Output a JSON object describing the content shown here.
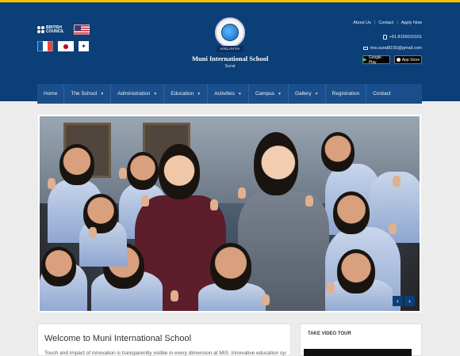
{
  "header": {
    "british_council_label": "BRITISH COUNCIL",
    "school_name": "Muni International School",
    "crest_text": "AIKLAVYA",
    "school_city": "Surat",
    "top_links": [
      "About Us",
      "Contact",
      "Apply Now"
    ],
    "phone": "+91 8155010101",
    "email": "mis.surat8155@gmail.com",
    "google_play_label": "Google Play",
    "app_store_label": "App Store"
  },
  "nav": {
    "items": [
      {
        "label": "Home",
        "dropdown": false
      },
      {
        "label": "The School",
        "dropdown": true
      },
      {
        "label": "Administration",
        "dropdown": true
      },
      {
        "label": "Education",
        "dropdown": true
      },
      {
        "label": "Activities",
        "dropdown": true
      },
      {
        "label": "Campus",
        "dropdown": true
      },
      {
        "label": "Gallery",
        "dropdown": true
      },
      {
        "label": "Registration",
        "dropdown": false
      },
      {
        "label": "Contact",
        "dropdown": false
      }
    ]
  },
  "slider": {
    "prev_icon": "‹",
    "next_icon": "›"
  },
  "welcome": {
    "title": "Welcome to Muni International School",
    "body": "Touch and impact of innovation is transparently visible in every dimension at MIS. Innovative education system, all"
  },
  "video_tour": {
    "title": "TAKE VIDEO TOUR"
  },
  "colors": {
    "header_bg": "#0c3f77",
    "nav_bg": "#1b4f8c",
    "accent_top": "#f2c200"
  }
}
